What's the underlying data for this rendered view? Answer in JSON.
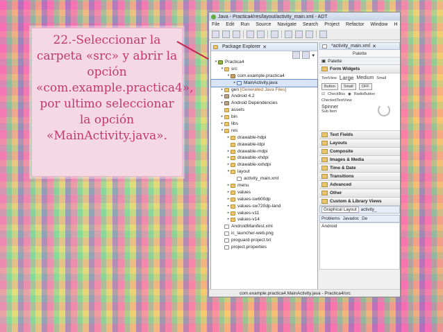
{
  "caption": {
    "text": "22.-Seleccionar la carpeta «src» y abrir la opción «com.example.practica4», por ultimo seleccionar la opción «MainActivity.java»."
  },
  "window": {
    "title": "Java - Practica4/res/layout/activity_main.xml - ADT",
    "menu": [
      "File",
      "Edit",
      "Run",
      "Source",
      "Navigate",
      "Search",
      "Project",
      "Refactor",
      "Window",
      "H"
    ]
  },
  "package_explorer": {
    "tab_label": "Package Explorer",
    "tree": [
      {
        "label": "Practica4",
        "depth": 0,
        "icon": "project-icon",
        "twisty": "▾"
      },
      {
        "label": "src",
        "depth": 1,
        "icon": "folder-icon",
        "twisty": "▾"
      },
      {
        "label": "com.example.practica4",
        "depth": 2,
        "icon": "package-icon",
        "twisty": "▾"
      },
      {
        "label": "MainActivity.java",
        "depth": 3,
        "icon": "java-file-icon",
        "twisty": "▸",
        "selected": true
      },
      {
        "label": "gen",
        "note": "[Generated Java Files]",
        "depth": 1,
        "icon": "folder-icon",
        "twisty": "▸"
      },
      {
        "label": "Android 4.2",
        "depth": 1,
        "icon": "library-icon",
        "twisty": "▸"
      },
      {
        "label": "Android Dependencies",
        "depth": 1,
        "icon": "library-icon",
        "twisty": "▸"
      },
      {
        "label": "assets",
        "depth": 1,
        "icon": "folder-icon",
        "twisty": ""
      },
      {
        "label": "bin",
        "depth": 1,
        "icon": "folder-icon",
        "twisty": "▸"
      },
      {
        "label": "libs",
        "depth": 1,
        "icon": "folder-icon",
        "twisty": "▸"
      },
      {
        "label": "res",
        "depth": 1,
        "icon": "folder-icon",
        "twisty": "▾"
      },
      {
        "label": "drawable-hdpi",
        "depth": 2,
        "icon": "folder-icon",
        "twisty": "▸"
      },
      {
        "label": "drawable-ldpi",
        "depth": 2,
        "icon": "folder-icon",
        "twisty": ""
      },
      {
        "label": "drawable-mdpi",
        "depth": 2,
        "icon": "folder-icon",
        "twisty": "▸"
      },
      {
        "label": "drawable-xhdpi",
        "depth": 2,
        "icon": "folder-icon",
        "twisty": "▸"
      },
      {
        "label": "drawable-xxhdpi",
        "depth": 2,
        "icon": "folder-icon",
        "twisty": "▸"
      },
      {
        "label": "layout",
        "depth": 2,
        "icon": "folder-icon",
        "twisty": "▾"
      },
      {
        "label": "activity_main.xml",
        "depth": 3,
        "icon": "file-icon",
        "twisty": ""
      },
      {
        "label": "menu",
        "depth": 2,
        "icon": "folder-icon",
        "twisty": "▸"
      },
      {
        "label": "values",
        "depth": 2,
        "icon": "folder-icon",
        "twisty": "▸"
      },
      {
        "label": "values-sw600dp",
        "depth": 2,
        "icon": "folder-icon",
        "twisty": "▸"
      },
      {
        "label": "values-sw720dp-land",
        "depth": 2,
        "icon": "folder-icon",
        "twisty": "▸"
      },
      {
        "label": "values-v11",
        "depth": 2,
        "icon": "folder-icon",
        "twisty": "▸"
      },
      {
        "label": "values-v14",
        "depth": 2,
        "icon": "folder-icon",
        "twisty": "▸"
      },
      {
        "label": "AndroidManifest.xml",
        "depth": 1,
        "icon": "file-icon",
        "twisty": ""
      },
      {
        "label": "ic_launcher-web.png",
        "depth": 1,
        "icon": "file-icon",
        "twisty": ""
      },
      {
        "label": "proguard-project.txt",
        "depth": 1,
        "icon": "file-icon",
        "twisty": ""
      },
      {
        "label": "project.properties",
        "depth": 1,
        "icon": "file-icon",
        "twisty": ""
      }
    ]
  },
  "editor": {
    "tab_label": "*activity_main.xml",
    "palette_header": "Palette",
    "palette_bar_label": "Palette",
    "form_widgets_label": "Form Widgets",
    "widgets": {
      "textview": "TextView",
      "large": "Large",
      "medium": "Medium",
      "small": "Small",
      "button": "Button",
      "small_button": "Small",
      "off": "OFF",
      "checkbox": "CheckBox",
      "radio": "RadioButton",
      "checked_textview": "CheckedTextView",
      "spinner": "Spinner",
      "sub_item": "Sub Item"
    },
    "categories": [
      "Text Fields",
      "Layouts",
      "Composite",
      "Images & Media",
      "Time & Date",
      "Transitions",
      "Advanced",
      "Other",
      "Custom & Library Views"
    ],
    "bottom_tabs": [
      "Graphical Layout",
      "activity_"
    ],
    "problems_tabs": [
      "Problems",
      "Javadoc",
      "De"
    ],
    "console_text": "Android"
  },
  "statusbar": {
    "text": "com.example.practica4.MainActivity.java - Practica4/src"
  }
}
